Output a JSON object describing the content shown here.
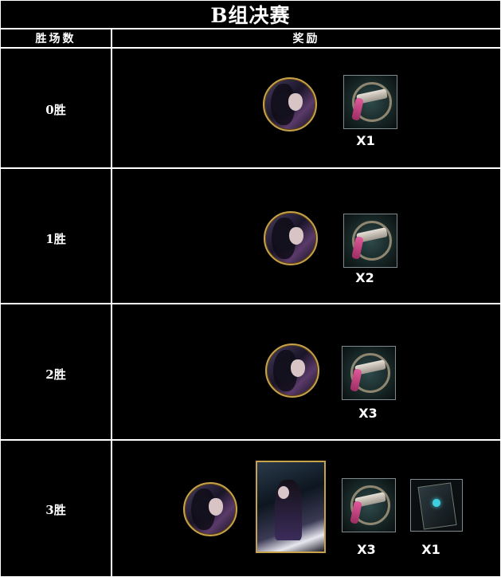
{
  "title": "B组决赛",
  "header": {
    "wins_col": "胜场数",
    "reward_col": "奖励"
  },
  "rows": [
    {
      "label": "0胜",
      "rewards": [
        {
          "kind": "avatar",
          "icon": "character-avatar-icon"
        },
        {
          "kind": "item",
          "icon": "pistol-item-icon",
          "qty": "X1"
        }
      ]
    },
    {
      "label": "1胜",
      "rewards": [
        {
          "kind": "avatar",
          "icon": "character-avatar-icon"
        },
        {
          "kind": "item",
          "icon": "pistol-item-icon",
          "qty": "X2"
        }
      ]
    },
    {
      "label": "2胜",
      "rewards": [
        {
          "kind": "avatar",
          "icon": "character-avatar-icon"
        },
        {
          "kind": "item",
          "icon": "pistol-item-icon",
          "qty": "X3"
        }
      ]
    },
    {
      "label": "3胜",
      "rewards": [
        {
          "kind": "avatar",
          "icon": "character-avatar-icon"
        },
        {
          "kind": "card",
          "icon": "character-card-icon"
        },
        {
          "kind": "item",
          "icon": "pistol-item-icon",
          "qty": "X3"
        },
        {
          "kind": "item",
          "icon": "card-back-item-icon",
          "qty": "X1"
        }
      ]
    }
  ],
  "colors": {
    "background": "#000000",
    "grid": "#ffffff",
    "frame_gold": "#c7a24a"
  }
}
